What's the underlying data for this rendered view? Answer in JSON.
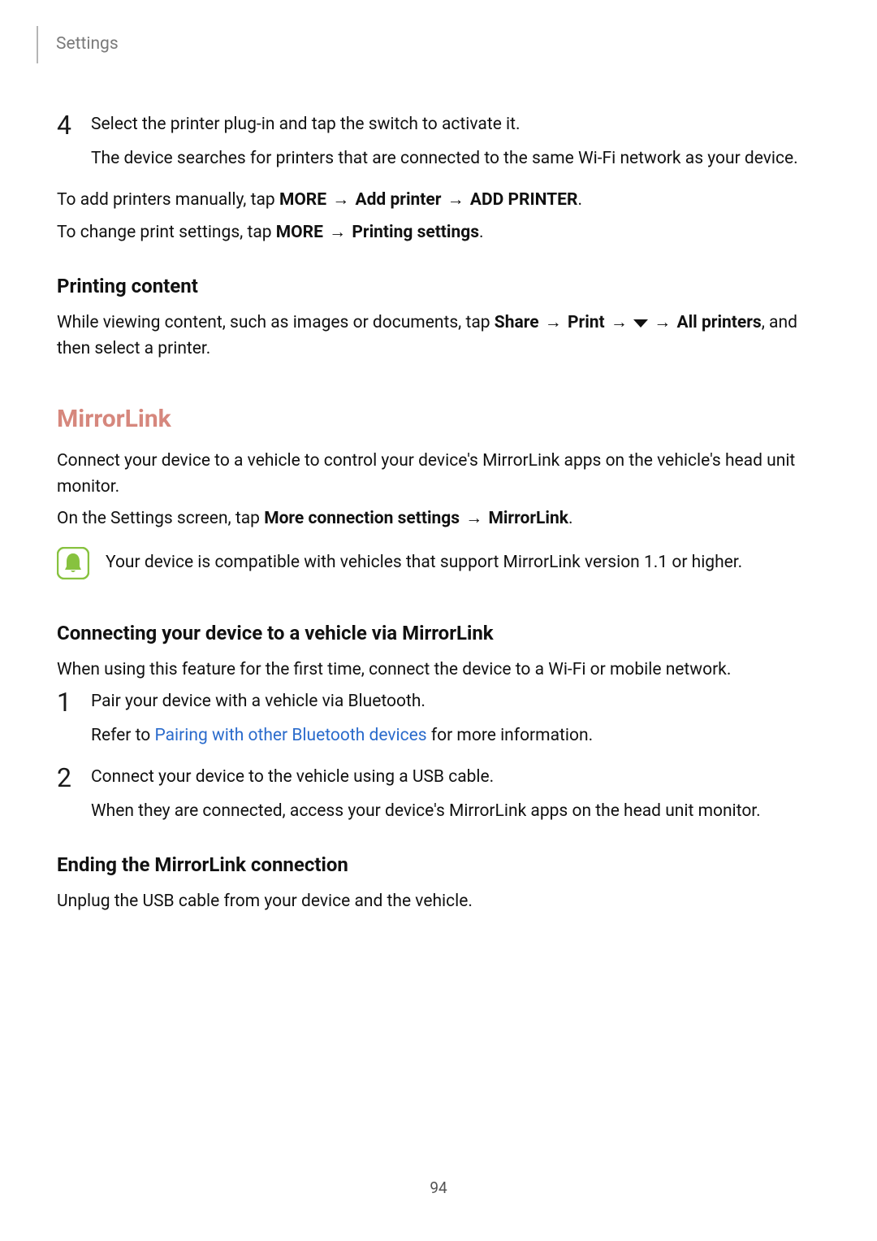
{
  "header": {
    "section": "Settings"
  },
  "step4": {
    "num": "4",
    "line1": "Select the printer plug-in and tap the switch to activate it.",
    "line2": "The device searches for printers that are connected to the same Wi-Fi network as your device."
  },
  "add_printers": {
    "prefix": "To add printers manually, tap ",
    "b1": "MORE",
    "arrow": " → ",
    "b2": "Add printer",
    "b3": "ADD PRINTER",
    "suffix": "."
  },
  "change_settings": {
    "prefix": "To change print settings, tap ",
    "b1": "MORE",
    "arrow": " → ",
    "b2": "Printing settings",
    "suffix": "."
  },
  "printing_content": {
    "heading": "Printing content",
    "prefix": "While viewing content, such as images or documents, tap ",
    "b1": "Share",
    "arrow": " → ",
    "b2": "Print",
    "b3": "All printers",
    "suffix": ", and then select a printer."
  },
  "mirrorlink": {
    "heading": "MirrorLink",
    "intro": "Connect your device to a vehicle to control your device's MirrorLink apps on the vehicle's head unit monitor.",
    "nav_prefix": "On the Settings screen, tap ",
    "nav_b1": "More connection settings",
    "nav_arrow": " → ",
    "nav_b2": "MirrorLink",
    "nav_suffix": ".",
    "note": "Your device is compatible with vehicles that support MirrorLink version 1.1 or higher."
  },
  "connecting": {
    "heading": "Connecting your device to a vehicle via MirrorLink",
    "intro": "When using this feature for the first time, connect the device to a Wi-Fi or mobile network.",
    "step1": {
      "num": "1",
      "line1": "Pair your device with a vehicle via Bluetooth.",
      "line2a": "Refer to ",
      "link": "Pairing with other Bluetooth devices",
      "line2b": " for more information."
    },
    "step2": {
      "num": "2",
      "line1": "Connect your device to the vehicle using a USB cable.",
      "line2": "When they are connected, access your device's MirrorLink apps on the head unit monitor."
    }
  },
  "ending": {
    "heading": "Ending the MirrorLink connection",
    "body": "Unplug the USB cable from your device and the vehicle."
  },
  "page_number": "94"
}
